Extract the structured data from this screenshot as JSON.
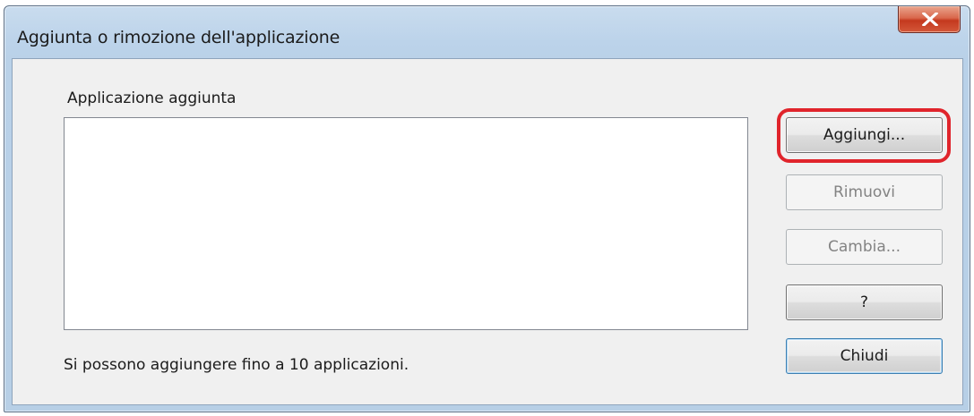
{
  "window": {
    "title": "Aggiunta o rimozione dell'applicazione",
    "close_icon": "close-x-icon"
  },
  "main": {
    "group_label": "Applicazione aggiunta",
    "list_items": [],
    "note": "Si possono aggiungere fino a 10 applicazioni."
  },
  "buttons": {
    "add": "Aggiungi...",
    "remove": "Rimuovi",
    "change": "Cambia...",
    "help": "?",
    "close": "Chiudi"
  },
  "colors": {
    "highlight": "#e0242b",
    "close_button": "#c4391e"
  }
}
